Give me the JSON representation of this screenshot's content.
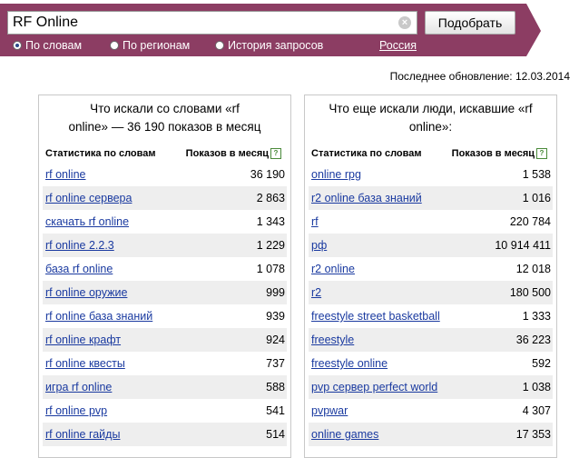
{
  "search": {
    "query": "RF Online",
    "clear_icon": "clear-circle-icon",
    "submit_label": "Подобрать",
    "modes": [
      {
        "label": "По словам",
        "selected": true
      },
      {
        "label": "По регионам",
        "selected": false
      },
      {
        "label": "История запросов",
        "selected": false
      }
    ],
    "region": "Россия"
  },
  "colors": {
    "banner": "#8c3d63",
    "link": "#1a3aa0",
    "row_alt": "#eeeeee"
  },
  "last_update": "Последнее обновление: 12.03.2014",
  "left_panel": {
    "title_line1": "Что искали со словами «rf",
    "title_line2": "online» — 36 190 показов в месяц",
    "col_keyword": "Статистика по словам",
    "col_count": "Показов в месяц",
    "rows": [
      {
        "phrase": "rf online",
        "count": "36 190"
      },
      {
        "phrase": "rf online сервера",
        "count": "2 863"
      },
      {
        "phrase": "скачать rf online",
        "count": "1 343"
      },
      {
        "phrase": "rf online 2.2.3",
        "count": "1 229"
      },
      {
        "phrase": "база rf online",
        "count": "1 078"
      },
      {
        "phrase": "rf online оружие",
        "count": "999"
      },
      {
        "phrase": "rf online база знаний",
        "count": "939"
      },
      {
        "phrase": "rf online крафт",
        "count": "924"
      },
      {
        "phrase": "rf online квесты",
        "count": "737"
      },
      {
        "phrase": "игра rf online",
        "count": "588"
      },
      {
        "phrase": "rf online pvp",
        "count": "541"
      },
      {
        "phrase": "rf online гайды",
        "count": "514"
      }
    ]
  },
  "right_panel": {
    "title_line1": "Что еще искали люди, искавшие «rf",
    "title_line2": "online»:",
    "col_keyword": "Статистика по словам",
    "col_count": "Показов в месяц",
    "rows": [
      {
        "phrase": "online rpg",
        "count": "1 538"
      },
      {
        "phrase": "r2 online база знаний",
        "count": "1 016"
      },
      {
        "phrase": "rf",
        "count": "220 784"
      },
      {
        "phrase": "рф",
        "count": "10 914 411"
      },
      {
        "phrase": "r2 online",
        "count": "12 018"
      },
      {
        "phrase": "r2",
        "count": "180 500"
      },
      {
        "phrase": "freestyle street basketball",
        "count": "1 333"
      },
      {
        "phrase": "freestyle",
        "count": "36 223"
      },
      {
        "phrase": "freestyle online",
        "count": "592"
      },
      {
        "phrase": "pvp сервер perfect world",
        "count": "1 038"
      },
      {
        "phrase": "pvpwar",
        "count": "4 307"
      },
      {
        "phrase": "online games",
        "count": "17 353"
      }
    ]
  }
}
